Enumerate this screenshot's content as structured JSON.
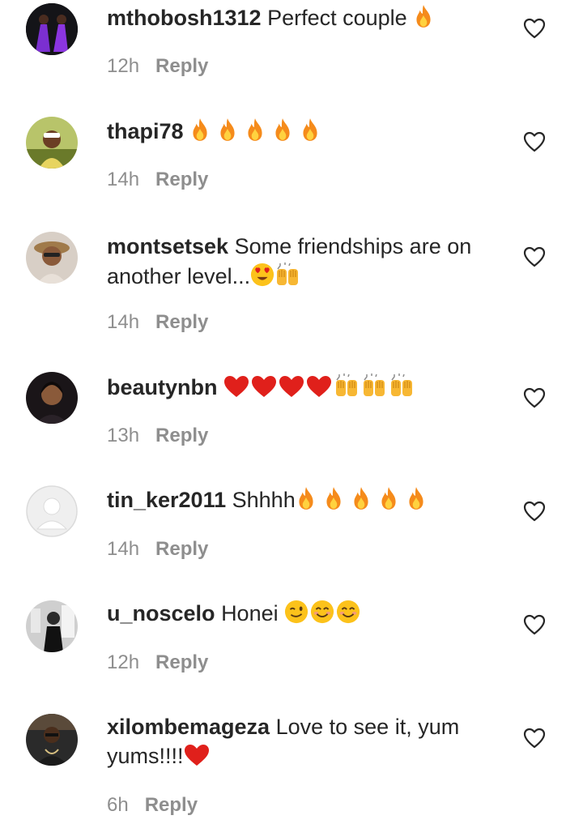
{
  "colors": {
    "text": "#262626",
    "meta": "#8e8e8e",
    "heart": "#262626",
    "fire": "#f58b1b",
    "red_heart": "#e0201b",
    "hands": "#f7b733",
    "face": "#fcc21b"
  },
  "comments": [
    {
      "username": "mthobosh1312",
      "text": "Perfect couple",
      "time": "12h",
      "reply": "Reply"
    },
    {
      "username": "thapi78",
      "text": "",
      "time": "14h",
      "reply": "Reply"
    },
    {
      "username": "montsetsek",
      "text": "Some friendships are on another level...",
      "time": "14h",
      "reply": "Reply"
    },
    {
      "username": "beautynbn",
      "text": "",
      "time": "13h",
      "reply": "Reply"
    },
    {
      "username": "tin_ker2011",
      "text": "Shhhh",
      "time": "14h",
      "reply": "Reply"
    },
    {
      "username": "u_noscelo",
      "text": "Honei",
      "time": "12h",
      "reply": "Reply"
    },
    {
      "username": "xilombemageza",
      "text": "Love to see it, yum yums!!!!",
      "time": "6h",
      "reply": "Reply"
    }
  ],
  "icons": {
    "like": "heart-outline-icon",
    "fire": "fire-emoji-icon",
    "love": "red-heart-emoji-icon",
    "raise": "raising-hands-emoji-icon",
    "heart_eyes": "heart-eyes-emoji-icon",
    "wink": "wink-emoji-icon",
    "smile": "smiling-face-emoji-icon",
    "default_avatar": "default-avatar-icon"
  }
}
